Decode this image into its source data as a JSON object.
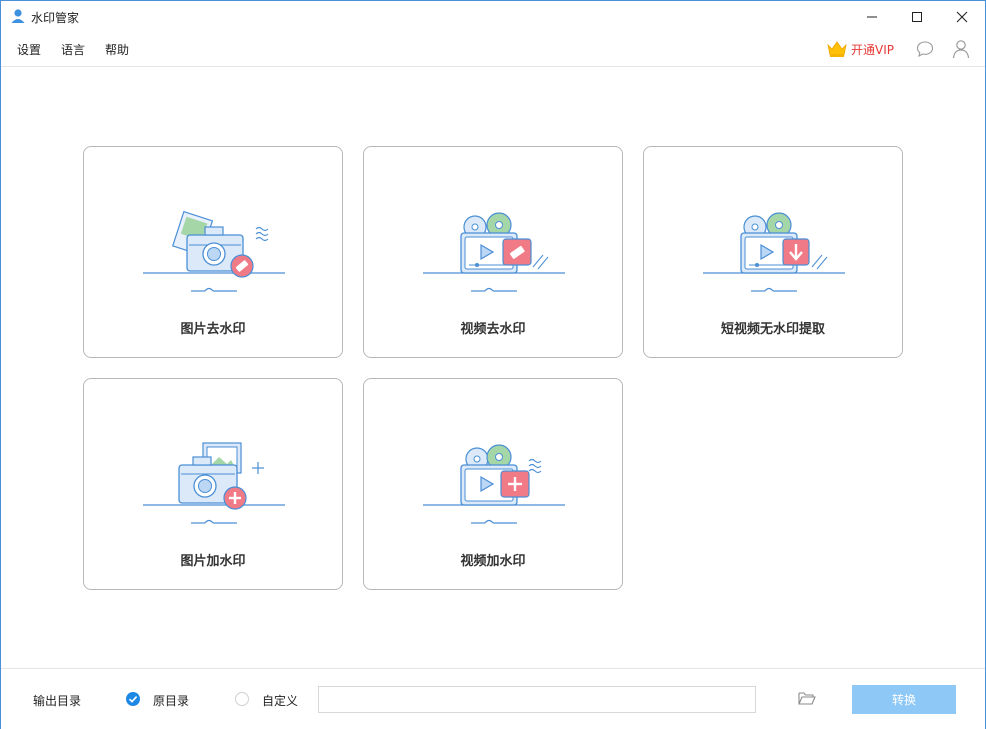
{
  "window": {
    "title": "水印管家"
  },
  "menu": {
    "items": [
      {
        "label": "设置"
      },
      {
        "label": "语言"
      },
      {
        "label": "帮助"
      }
    ],
    "vip_label": "开通VIP"
  },
  "cards": [
    {
      "label": "图片去水印",
      "icon": "photo-remove-watermark-icon"
    },
    {
      "label": "视频去水印",
      "icon": "video-remove-watermark-icon"
    },
    {
      "label": "短视频无水印提取",
      "icon": "short-video-extract-icon"
    },
    {
      "label": "图片加水印",
      "icon": "photo-add-watermark-icon"
    },
    {
      "label": "视频加水印",
      "icon": "video-add-watermark-icon"
    }
  ],
  "footer": {
    "output_label": "输出目录",
    "option_original": "原目录",
    "option_custom": "自定义",
    "selected_option": "原目录",
    "path_value": "",
    "convert_label": "转换"
  },
  "colors": {
    "accent": "#1e88e5",
    "convert_button": "#8dc8f7",
    "vip_text": "#e53935",
    "icon_blue": "#4a8fd6",
    "icon_red": "#f07a86",
    "icon_green": "#a5d6a7"
  }
}
